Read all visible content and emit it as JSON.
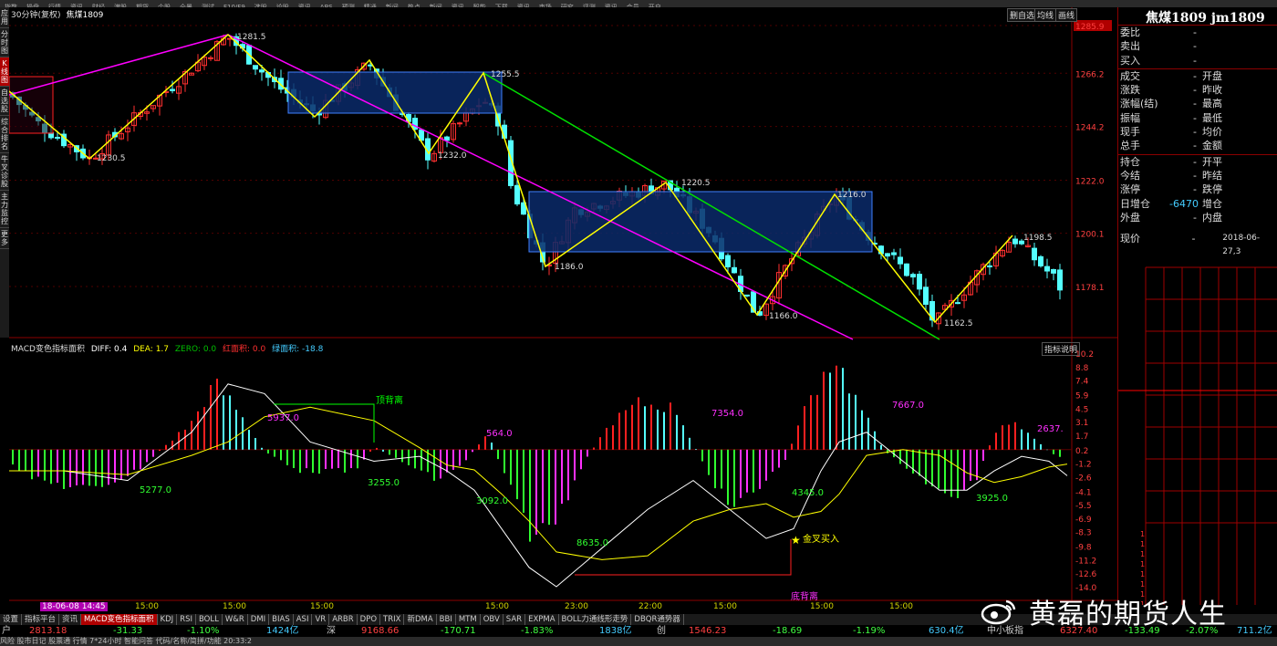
{
  "top_menu": [
    "指数",
    "操盘",
    "行情",
    "资讯",
    "财经",
    "港股",
    "期货",
    "个股",
    "全景",
    "测试",
    "F10/F9",
    "选股",
    "论股",
    "资讯",
    "ABS",
    "预测",
    "精通",
    "新闻",
    "热点",
    "新闻",
    "资讯",
    "智能",
    "下载",
    "资讯",
    "市场",
    "研究",
    "评测",
    "资讯",
    "会员",
    "开户"
  ],
  "left_tabs": [
    "应用",
    "分时图",
    "K线图",
    "自选股",
    "综合排名",
    "牛叉诊股",
    "主力监控",
    "更多"
  ],
  "chart_header": {
    "period": "30分钟(复权)",
    "symbol": "焦煤1809",
    "btn1": "删自选",
    "btn2": "均线",
    "btn3": "画线"
  },
  "price_axis": [
    "1285.9",
    "1266.2",
    "1244.2",
    "1222.0",
    "1200.1",
    "1178.1"
  ],
  "price_labels": [
    "1281.5",
    "1255.5",
    "1230.5",
    "1232.0",
    "1220.5",
    "1186.0",
    "1216.0",
    "1198.5",
    "1166.0",
    "1162.5"
  ],
  "macd": {
    "title": "MACD变色指标面积",
    "diff": "DIFF: 0.4",
    "dea": "DEA: 1.7",
    "zero": "ZERO: 0.0",
    "red": "红面积: 0.0",
    "green": "绿面积: -18.8",
    "explain": "指标说明",
    "axis": [
      "10.2",
      "8.8",
      "7.4",
      "5.9",
      "4.5",
      "3.1",
      "1.7",
      "0.2",
      "-1.2",
      "-2.6",
      "-4.1",
      "-5.5",
      "-6.9",
      "-8.3",
      "-9.8",
      "-11.2",
      "-12.6",
      "-14.0"
    ],
    "area_labels": [
      "5277.0",
      "5937.0",
      "3255.0",
      "564.0",
      "3092.0",
      "8635.0",
      "7354.0",
      "4345.0",
      "7667.0",
      "3925.0",
      "2637."
    ],
    "top_div": "顶背离",
    "bottom_div": "底背离",
    "gold_cross": "金叉买入"
  },
  "x_times": [
    "18-06-08 14:45",
    "15:00",
    "15:00",
    "15:00",
    "15:00",
    "23:00",
    "22:00",
    "15:00",
    "15:00",
    "15:00"
  ],
  "quote": {
    "title": "焦煤1809 jm1809",
    "rows": [
      [
        "委比",
        "-",
        ""
      ],
      [
        "卖出",
        "-",
        ""
      ],
      [
        "买入",
        "-",
        ""
      ],
      [
        "成交",
        "-",
        "开盘"
      ],
      [
        "涨跌",
        "-",
        "昨收"
      ],
      [
        "涨幅(结)",
        "-",
        "最高"
      ],
      [
        "振幅",
        "-",
        "最低"
      ],
      [
        "现手",
        "-",
        "均价"
      ],
      [
        "总手",
        "-",
        "金额"
      ],
      [
        "持仓",
        "-",
        "开平"
      ],
      [
        "今结",
        "-",
        "昨结"
      ],
      [
        "涨停",
        "-",
        "跌停"
      ],
      [
        "日增仓",
        "-6470",
        "增仓"
      ],
      [
        "外盘",
        "-",
        "内盘"
      ]
    ],
    "current_label": "现价",
    "current_val": "-",
    "date": "2018-06-27,3"
  },
  "bottom_tabs": [
    "设置",
    "指标平台",
    "资讯",
    "MACD变色指标面积",
    "KDJ",
    "RSI",
    "BOLL",
    "W&R",
    "DMI",
    "BIAS",
    "ASI",
    "VR",
    "ARBR",
    "DPO",
    "TRIX",
    "新DMA",
    "BBI",
    "MTM",
    "OBV",
    "SAR",
    "EXPMA",
    "BOLL力通线形走势",
    "DBQR通势器"
  ],
  "status": [
    [
      "户",
      "#ccc"
    ],
    [
      "2813.18",
      "#ff4040"
    ],
    [
      "-31.33",
      "#40ff40"
    ],
    [
      "-1.10%",
      "#40ff40"
    ],
    [
      "1424亿",
      "#4cf"
    ],
    [
      "深",
      "#ccc"
    ],
    [
      "9168.66",
      "#ff4040"
    ],
    [
      "-170.71",
      "#40ff40"
    ],
    [
      "-1.83%",
      "#40ff40"
    ],
    [
      "1838亿",
      "#4cf"
    ],
    [
      "创",
      "#ccc"
    ],
    [
      "1546.23",
      "#ff4040"
    ],
    [
      "-18.69",
      "#40ff40"
    ],
    [
      "-1.19%",
      "#40ff40"
    ],
    [
      "630.4亿",
      "#4cf"
    ],
    [
      "中小板指",
      "#ccc"
    ],
    [
      "6327.40",
      "#ff4040"
    ],
    [
      "-133.49",
      "#40ff40"
    ],
    [
      "-2.07%",
      "#40ff40"
    ],
    [
      "711.2亿",
      "#4cf"
    ]
  ],
  "bottom_bar": "风险 股市日记 股票通 行情 7*24小时 智能问答 代码/名称/简拼/功能 20:33:2",
  "watermark": "黄磊的期货人生"
}
